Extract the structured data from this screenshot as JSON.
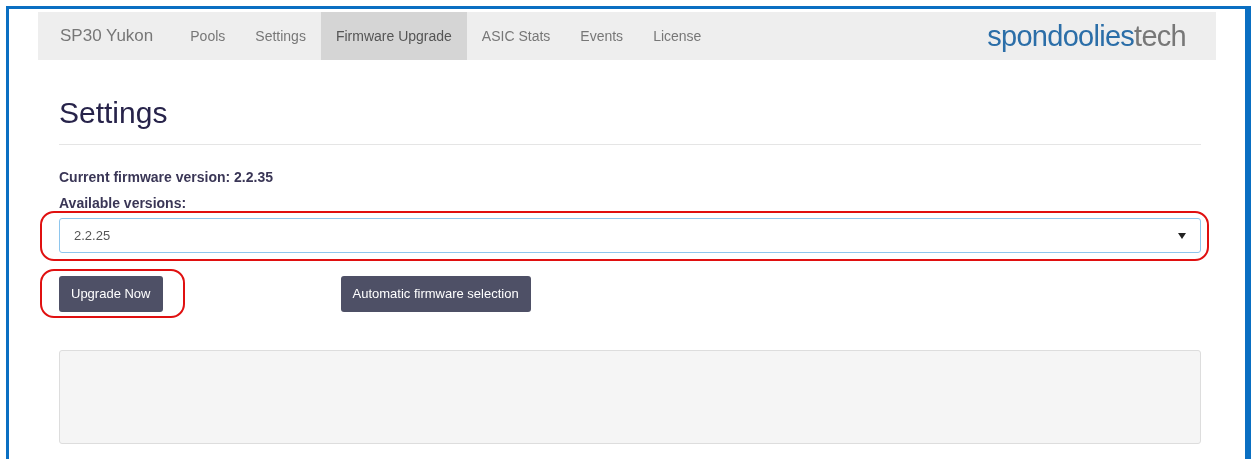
{
  "navbar": {
    "brand": "SP30 Yukon",
    "items": [
      {
        "label": "Pools",
        "selected": false
      },
      {
        "label": "Settings",
        "selected": false
      },
      {
        "label": "Firmware Upgrade",
        "selected": true
      },
      {
        "label": "ASIC Stats",
        "selected": false
      },
      {
        "label": "Events",
        "selected": false
      },
      {
        "label": "License",
        "selected": false
      }
    ],
    "logo": {
      "name": "spondoolies",
      "suffix": "tech"
    }
  },
  "heading": "Settings",
  "current_version": "Current firmware version: 2.2.35",
  "versions_label": "Available versions:",
  "versions_select": {
    "value": "2.2.25",
    "highlighted": true
  },
  "buttons": [
    {
      "label": "Upgrade Now",
      "highlighted": true
    },
    {
      "label": "Automatic firmware selection",
      "highlighted": false
    }
  ]
}
